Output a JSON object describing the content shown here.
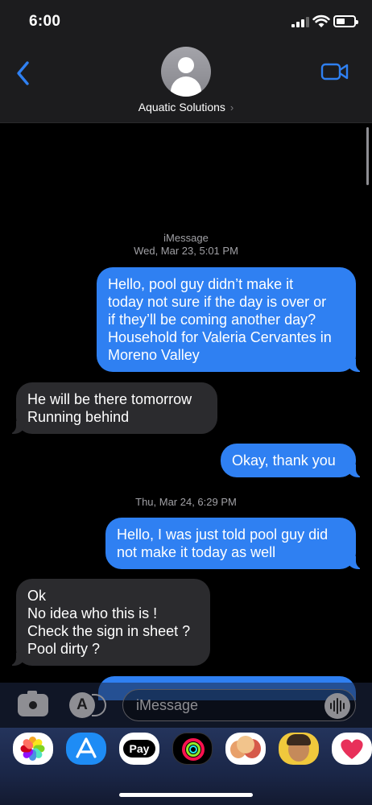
{
  "status_bar": {
    "time": "6:00"
  },
  "header": {
    "contact_name": "Aquatic Solutions",
    "chevron": "›"
  },
  "thread": {
    "service_label": "iMessage",
    "timestamp_1": "Wed, Mar 23, 5:01 PM",
    "timestamp_2": "Thu, Mar 24, 6:29 PM",
    "messages": [
      {
        "direction": "sent",
        "lines": [
          "Hello, pool guy didn’t make it",
          "today not sure if the day is over or",
          "if they’ll be coming another day?",
          "Household for Valeria Cervantes in",
          "Moreno Valley"
        ]
      },
      {
        "direction": "received",
        "lines": [
          "He will be there tomorrow",
          "Running behind"
        ]
      },
      {
        "direction": "sent",
        "lines": [
          "Okay, thank you"
        ]
      },
      {
        "direction": "sent",
        "lines": [
          "Hello, I was just told pool guy did",
          "not make it today as well"
        ]
      },
      {
        "direction": "received",
        "lines": [
          "Ok",
          "No idea who this is !",
          "Check the sign in sheet ?",
          "Pool dirty ?"
        ]
      }
    ]
  },
  "composer": {
    "placeholder": "iMessage",
    "apps_glyph": "A"
  },
  "drawer": {
    "pay_label": "Pay"
  },
  "colors": {
    "sent_bubble": "#2f80f2",
    "received_bubble": "#2b2b2e",
    "accent": "#2f80f2"
  },
  "icons": [
    "back-chevron-icon",
    "video-camera-icon",
    "camera-icon",
    "app-store-icon",
    "audio-waveform-icon",
    "photos-icon",
    "apple-pay-icon",
    "fitness-icon",
    "memoji-icon",
    "heart-icon"
  ]
}
